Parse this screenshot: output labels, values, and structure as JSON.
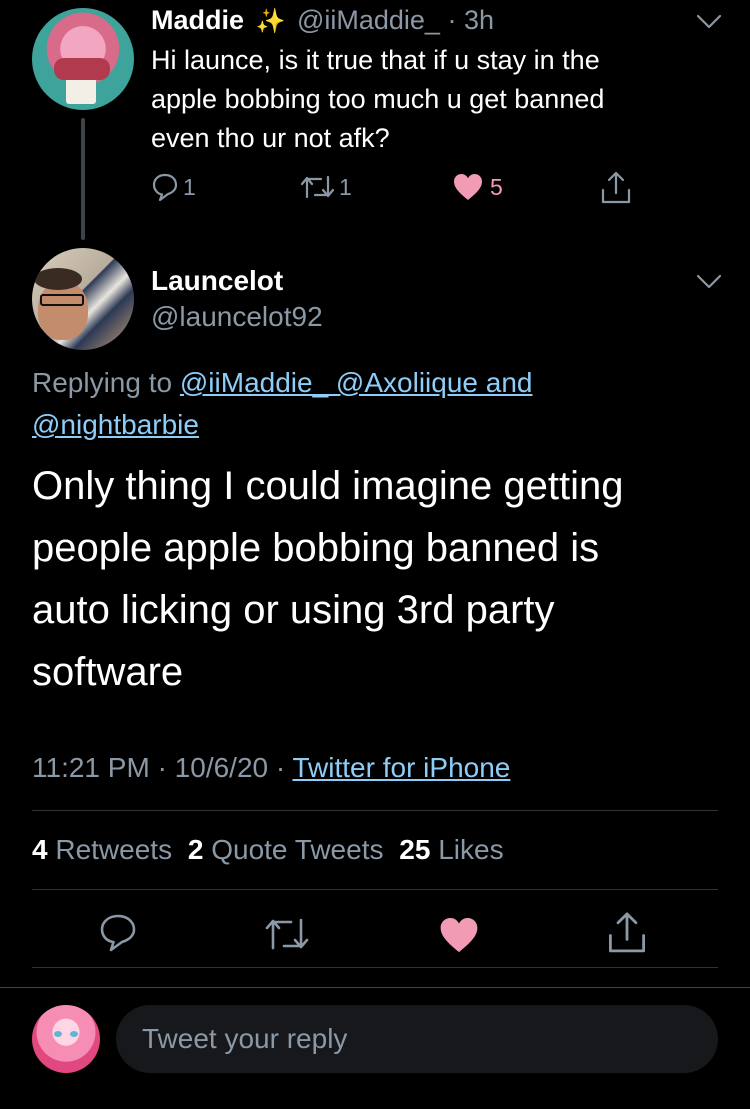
{
  "parent_tweet": {
    "display_name": "Maddie",
    "name_emoji": "✨",
    "handle": "@iiMaddie_",
    "separator": "·",
    "time_ago": "3h",
    "text_lines": [
      "Hi launce, is it true that if u stay in the",
      "apple bobbing too much u get banned",
      "even tho ur not afk?"
    ],
    "actions": {
      "reply_count": "1",
      "retweet_count": "1",
      "like_count": "5",
      "liked": true
    }
  },
  "main_tweet": {
    "display_name": "Launcelot",
    "handle": "@launcelot92",
    "replying_to_label": "Replying to",
    "replying_to_line1": "@iiMaddie_ @Axoliique and",
    "replying_to_line2": "@nightbarbie",
    "text_lines": [
      "Only thing I could imagine getting",
      "people apple bobbing banned is",
      "auto licking or using 3rd party",
      "software"
    ],
    "time": "11:21 PM",
    "date": "10/6/20",
    "separator": "·",
    "source": "Twitter for iPhone",
    "stats": {
      "retweets_count": "4",
      "retweets_label": "Retweets",
      "quote_count": "2",
      "quote_label": "Quote Tweets",
      "likes_count": "25",
      "likes_label": "Likes"
    },
    "liked": true
  },
  "reply_box": {
    "placeholder": "Tweet your reply"
  },
  "colors": {
    "background": "#000000",
    "link": "#8ecdf8",
    "like": "#f19bb5",
    "muted": "#8b98a5",
    "divider": "#2f3336",
    "input_bg": "#16181c"
  }
}
